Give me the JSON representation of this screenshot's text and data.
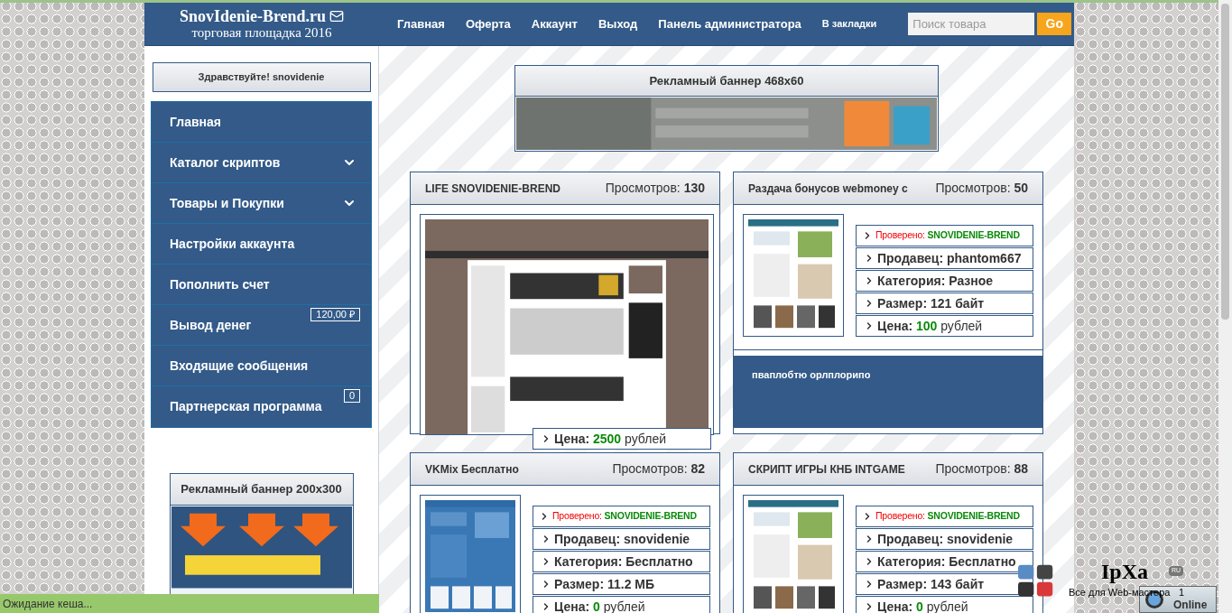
{
  "header": {
    "logo_title": "SnovIdenie-Brend.ru",
    "logo_subtitle": "торговая площадка 2016",
    "nav": [
      "Главная",
      "Оферта",
      "Аккаунт",
      "Выход",
      "Панель администратора",
      "В закладки"
    ],
    "search": {
      "placeholder": "Поиск товара"
    },
    "go_button": "Go"
  },
  "sidebar": {
    "greeting": "Здравствуйте! snovidenie",
    "menu": [
      {
        "label": "Главная",
        "kind": "plain"
      },
      {
        "label": "Каталог скриптов",
        "kind": "dropdown"
      },
      {
        "label": "Товары и Покупки",
        "kind": "dropdown"
      },
      {
        "label": "Настройки аккаунта",
        "kind": "plain"
      },
      {
        "label": "Пополнить счет",
        "kind": "plain"
      },
      {
        "label": "Вывод денег",
        "kind": "badge",
        "badge": "120,00 ₽"
      },
      {
        "label": "Входящие сообщения",
        "kind": "plain"
      },
      {
        "label": "Партнерская программа",
        "kind": "badge",
        "badge": "0"
      }
    ],
    "banner_title": "Рекламный баннер 200x300"
  },
  "main": {
    "banner_title": "Рекламный баннер 468x60",
    "products": [
      {
        "title": "LIFE SNOVIDENIE-BREND",
        "views_label": "Просмотров:",
        "views": "130",
        "kind": "wide",
        "info": [
          {
            "kind": "price",
            "label": "Цена:",
            "value": "2500",
            "unit": "рублей"
          }
        ]
      },
      {
        "title": "Раздача бонусов webmoney с",
        "views_label": "Просмотров:",
        "views": "50",
        "kind": "thumb",
        "info": [
          {
            "kind": "verified",
            "label": "Проверено:",
            "value": "SNOVIDENIE-BREND"
          },
          {
            "kind": "text",
            "label": "Продавец: phantom667"
          },
          {
            "kind": "text",
            "label": "Категория: Разное"
          },
          {
            "kind": "text",
            "label": "Размер: 121 байт"
          },
          {
            "kind": "price",
            "label": "Цена:",
            "value": "100",
            "unit": "рублей"
          }
        ],
        "note": "пваплобтю орлплорипо"
      },
      {
        "title": "VKMix Бесплатно",
        "views_label": "Просмотров:",
        "views": "82",
        "kind": "thumb",
        "info": [
          {
            "kind": "verified",
            "label": "Проверено:",
            "value": "SNOVIDENIE-BREND"
          },
          {
            "kind": "text",
            "label": "Продавец: snovidenie"
          },
          {
            "kind": "text",
            "label": "Категория: Бесплатно"
          },
          {
            "kind": "text",
            "label": "Размер: 11.2 МБ"
          },
          {
            "kind": "price",
            "label": "Цена:",
            "value": "0",
            "unit": "рублей"
          }
        ]
      },
      {
        "title": "СКРИПТ ИГРЫ КНБ INTGAME",
        "views_label": "Просмотров:",
        "views": "88",
        "kind": "thumb",
        "info": [
          {
            "kind": "verified",
            "label": "Проверено:",
            "value": "SNOVIDENIE-BREND"
          },
          {
            "kind": "text",
            "label": "Продавец: snovidenie"
          },
          {
            "kind": "text",
            "label": "Категория: Бесплатно"
          },
          {
            "kind": "text",
            "label": "Размер: 143 байт"
          },
          {
            "kind": "price",
            "label": "Цена:",
            "value": "0",
            "unit": "рублей"
          }
        ]
      }
    ]
  },
  "status_bar": "Ожидание кеша...",
  "widget": {
    "logo": "IpXa",
    "badge": "RU",
    "tagline": "Все для Web-мастера",
    "count": "1",
    "status": "Online"
  }
}
